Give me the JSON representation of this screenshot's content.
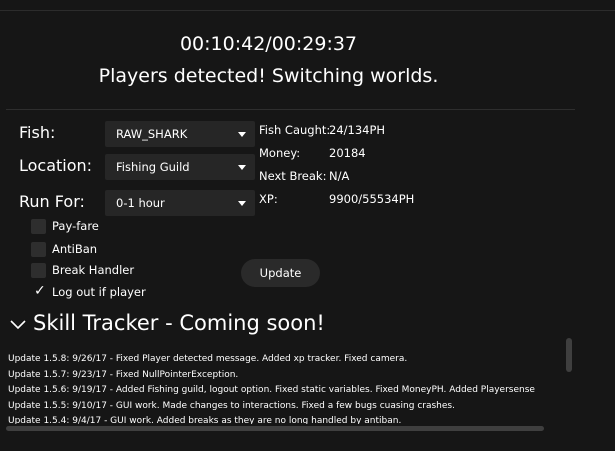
{
  "timer": "00:10:42/00:29:37",
  "status": "Players detected! Switching worlds.",
  "form": {
    "fish_label": "Fish:",
    "fish_value": "RAW_SHARK",
    "location_label": "Location:",
    "location_value": "Fishing Guild",
    "runfor_label": "Run For:",
    "runfor_value": "0-1 hour"
  },
  "options": [
    {
      "label": "Pay-fare",
      "checked": false
    },
    {
      "label": "AntiBan",
      "checked": false
    },
    {
      "label": "Break Handler",
      "checked": false
    },
    {
      "label": "Log out if player",
      "checked": true
    }
  ],
  "stats": {
    "fish_caught_label": "Fish Caught:",
    "fish_caught_value": "24/134PH",
    "money_label": "Money:",
    "money_value": "20184",
    "next_break_label": "Next Break:",
    "next_break_value": "N/A",
    "xp_label": "XP:",
    "xp_value": "9900/55534PH"
  },
  "update_button": "Update",
  "skill_tracker_title": "Skill Tracker - Coming soon!",
  "updates": [
    "Update 1.5.8:  9/26/17 - Fixed Player detected message. Added xp tracker. Fixed camera.",
    "Update 1.5.7:  9/23/17 - Fixed NullPointerException.",
    "Update 1.5.6:  9/19/17 - Added Fishing guild, logout option. Fixed static variables. Fixed MoneyPH. Added Playersense",
    "Update 1.5.5:  9/10/17 - GUI work. Made changes to interactions. Fixed a few bugs cuasing crashes.",
    "Update 1.5.4:  9/4/17 - GUI work. Added breaks as they are no long handled by antiban."
  ]
}
